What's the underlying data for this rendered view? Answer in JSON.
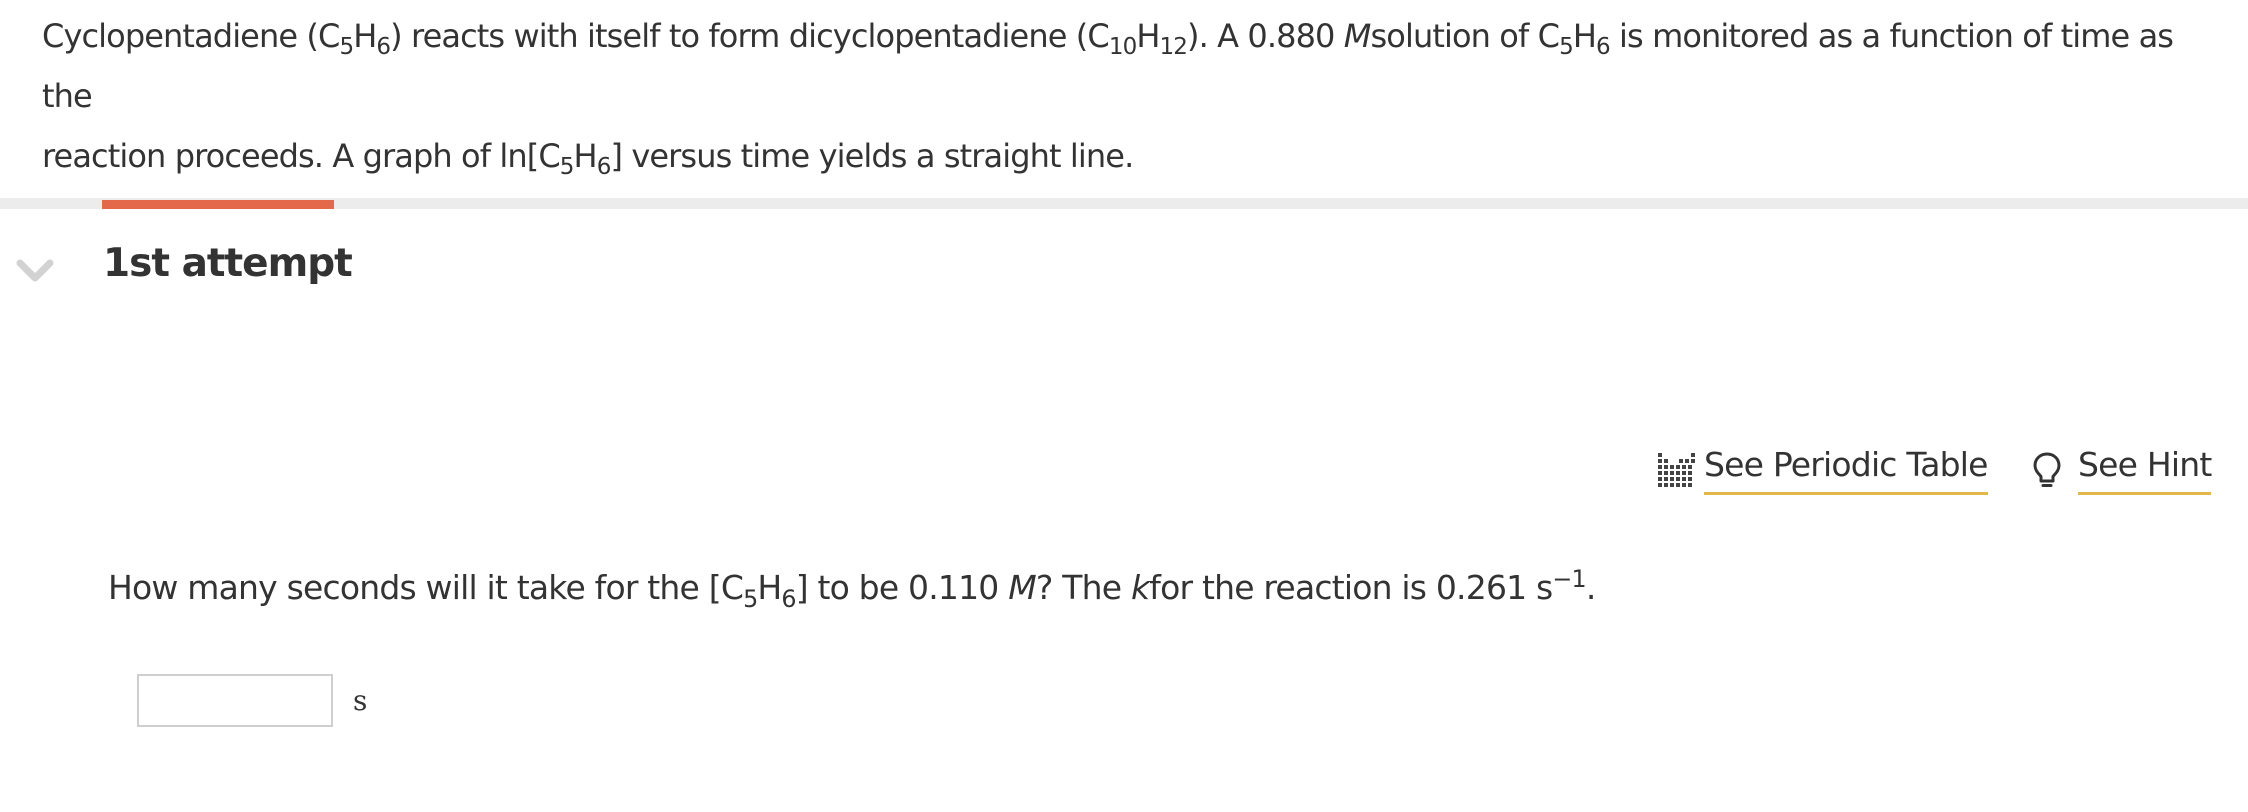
{
  "intro": {
    "line1": {
      "t1": "Cyclopentadiene (C",
      "s1": "5",
      "t2": "H",
      "s2": "6",
      "t3": ") reacts with itself to form dicyclopentadiene (C",
      "s3": "10",
      "t4": "H",
      "s4": "12",
      "t5": "). A 0.880 ",
      "m": "M",
      "t6": "solution of C",
      "s5": "5",
      "t7": "H",
      "s6": "6",
      "t8": " is monitored as a function of time as the"
    },
    "line2": {
      "t1": "reaction proceeds. A graph of ln[C",
      "s1": "5",
      "t2": "H",
      "s2": "6",
      "t3": "] versus time yields a straight line."
    }
  },
  "progress": {
    "fraction": 0.103,
    "color": "#e4694b",
    "track_color": "#ececec"
  },
  "attempt": {
    "label": "1st attempt",
    "icon": "chevron-down-icon"
  },
  "tools": {
    "periodic_table": {
      "label": "See Periodic Table",
      "icon": "periodic-table-icon"
    },
    "hint": {
      "label": "See Hint",
      "icon": "lightbulb-icon"
    },
    "underline_color": "#e2b84b"
  },
  "question": {
    "t1": "How many seconds will it take for the [C",
    "s1": "5",
    "t2": "H",
    "s2": "6",
    "t3": "] to be 0.110 ",
    "m": "M",
    "t4": "? The ",
    "k": "k",
    "t5": "for the reaction is 0.261 s",
    "sup": "−1",
    "t6": "."
  },
  "answer": {
    "value": "",
    "unit": "s"
  }
}
